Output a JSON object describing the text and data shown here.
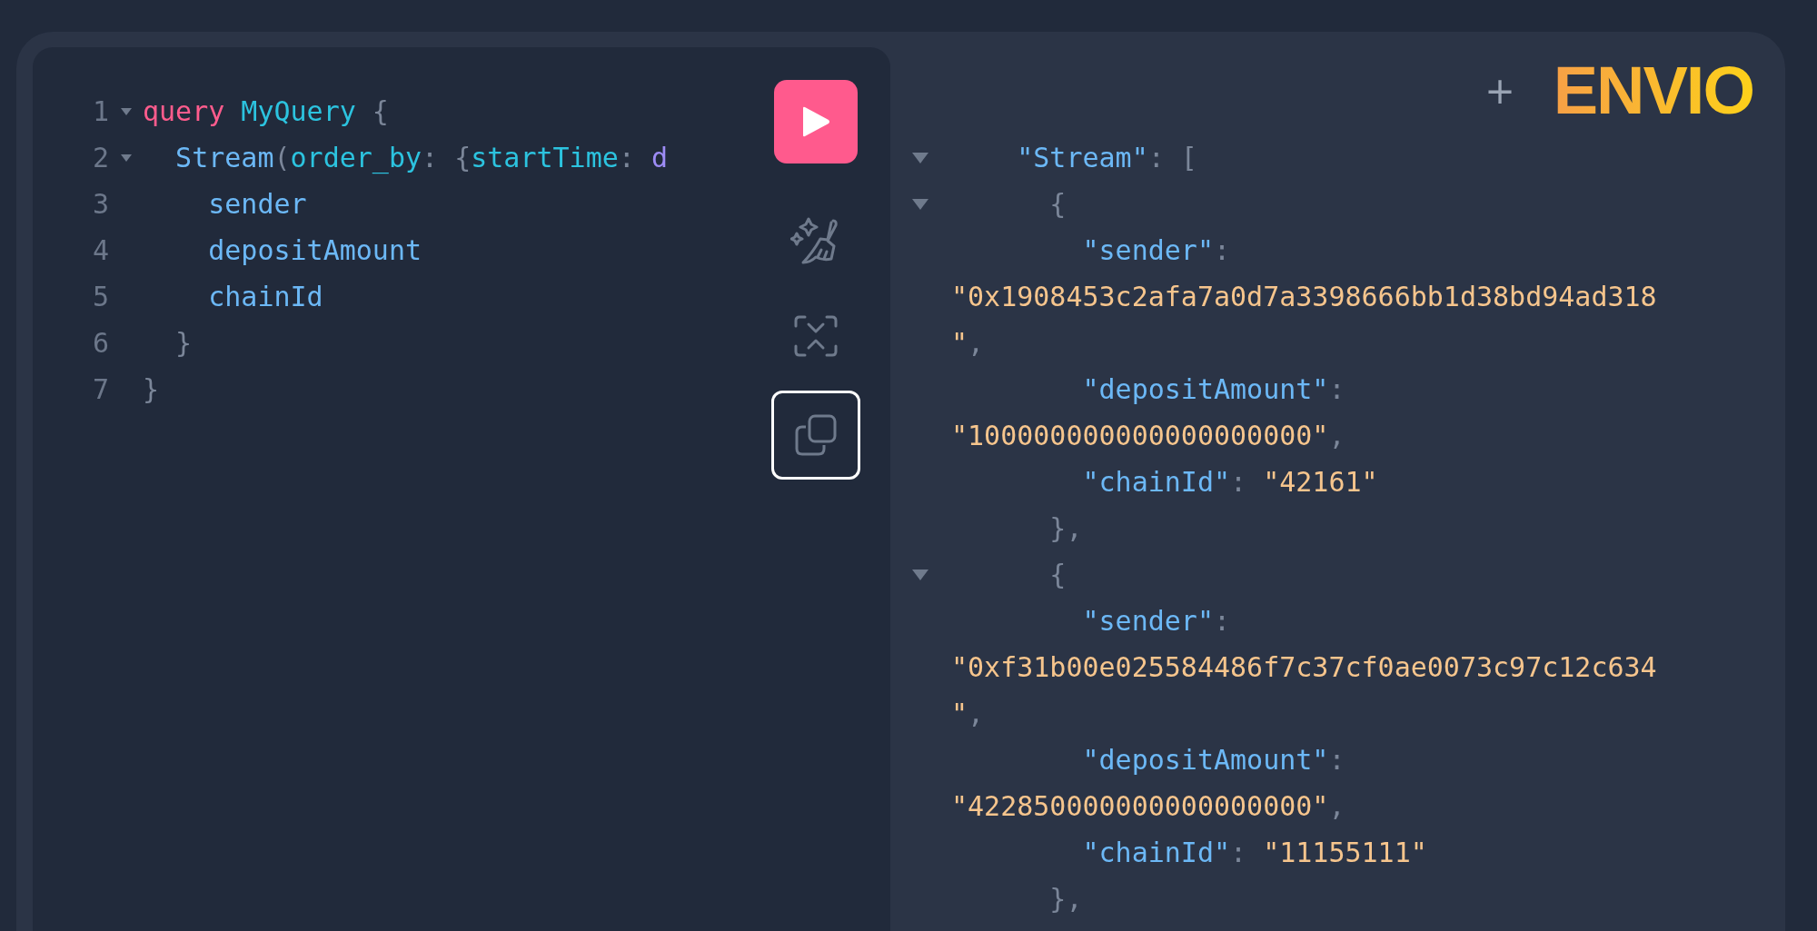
{
  "editor": {
    "lines": [
      {
        "number": "1",
        "foldable": true,
        "tokens": [
          {
            "text": "query",
            "kind": "keyword"
          },
          {
            "text": " MyQuery",
            "kind": "name"
          },
          {
            "text": " {",
            "kind": "punct"
          }
        ]
      },
      {
        "number": "2",
        "foldable": true,
        "tokens": [
          {
            "text": "  Stream",
            "kind": "field"
          },
          {
            "text": "(",
            "kind": "punct"
          },
          {
            "text": "order_by",
            "kind": "name"
          },
          {
            "text": ": {",
            "kind": "punct"
          },
          {
            "text": "startTime",
            "kind": "name"
          },
          {
            "text": ": ",
            "kind": "punct"
          },
          {
            "text": "d",
            "kind": "enum"
          }
        ]
      },
      {
        "number": "3",
        "foldable": false,
        "tokens": [
          {
            "text": "    sender",
            "kind": "field"
          }
        ]
      },
      {
        "number": "4",
        "foldable": false,
        "tokens": [
          {
            "text": "    depositAmount",
            "kind": "field"
          }
        ]
      },
      {
        "number": "5",
        "foldable": false,
        "tokens": [
          {
            "text": "    chainId",
            "kind": "field"
          }
        ]
      },
      {
        "number": "6",
        "foldable": false,
        "tokens": [
          {
            "text": "  }",
            "kind": "punct"
          }
        ]
      },
      {
        "number": "7",
        "foldable": false,
        "tokens": [
          {
            "text": "}",
            "kind": "punct"
          }
        ]
      }
    ],
    "tools": [
      {
        "kind": "run",
        "focused": false
      },
      {
        "kind": "prettify",
        "focused": false
      },
      {
        "kind": "merge",
        "focused": false
      },
      {
        "kind": "copy",
        "focused": true
      }
    ]
  },
  "result": {
    "add_label": "+",
    "logo": "ENVIO",
    "lines": [
      {
        "foldable": true,
        "tokens": [
          {
            "text": "    \"Stream\"",
            "kind": "key"
          },
          {
            "text": ": [",
            "kind": "punct"
          }
        ]
      },
      {
        "foldable": true,
        "tokens": [
          {
            "text": "      {",
            "kind": "punct"
          }
        ]
      },
      {
        "foldable": false,
        "tokens": [
          {
            "text": "        \"sender\"",
            "kind": "key"
          },
          {
            "text": ":",
            "kind": "punct"
          }
        ]
      },
      {
        "foldable": false,
        "tokens": [
          {
            "text": "\"0x1908453c2afa7a0d7a3398666bb1d38bd94ad318",
            "kind": "string"
          }
        ]
      },
      {
        "foldable": false,
        "tokens": [
          {
            "text": "\"",
            "kind": "string"
          },
          {
            "text": ",",
            "kind": "punct"
          }
        ]
      },
      {
        "foldable": false,
        "tokens": [
          {
            "text": "        \"depositAmount\"",
            "kind": "key"
          },
          {
            "text": ":",
            "kind": "punct"
          }
        ]
      },
      {
        "foldable": false,
        "tokens": [
          {
            "text": "\"100000000000000000000\"",
            "kind": "string"
          },
          {
            "text": ",",
            "kind": "punct"
          }
        ]
      },
      {
        "foldable": false,
        "tokens": [
          {
            "text": "        \"chainId\"",
            "kind": "key"
          },
          {
            "text": ": ",
            "kind": "punct"
          },
          {
            "text": "\"42161\"",
            "kind": "string"
          }
        ]
      },
      {
        "foldable": false,
        "tokens": [
          {
            "text": "      },",
            "kind": "punct"
          }
        ]
      },
      {
        "foldable": true,
        "tokens": [
          {
            "text": "      {",
            "kind": "punct"
          }
        ]
      },
      {
        "foldable": false,
        "tokens": [
          {
            "text": "        \"sender\"",
            "kind": "key"
          },
          {
            "text": ":",
            "kind": "punct"
          }
        ]
      },
      {
        "foldable": false,
        "tokens": [
          {
            "text": "\"0xf31b00e025584486f7c37cf0ae0073c97c12c634",
            "kind": "string"
          }
        ]
      },
      {
        "foldable": false,
        "tokens": [
          {
            "text": "\"",
            "kind": "string"
          },
          {
            "text": ",",
            "kind": "punct"
          }
        ]
      },
      {
        "foldable": false,
        "tokens": [
          {
            "text": "        \"depositAmount\"",
            "kind": "key"
          },
          {
            "text": ":",
            "kind": "punct"
          }
        ]
      },
      {
        "foldable": false,
        "tokens": [
          {
            "text": "\"422850000000000000000\"",
            "kind": "string"
          },
          {
            "text": ",",
            "kind": "punct"
          }
        ]
      },
      {
        "foldable": false,
        "tokens": [
          {
            "text": "        \"chainId\"",
            "kind": "key"
          },
          {
            "text": ": ",
            "kind": "punct"
          },
          {
            "text": "\"11155111\"",
            "kind": "string"
          }
        ]
      },
      {
        "foldable": false,
        "tokens": [
          {
            "text": "      },",
            "kind": "punct"
          }
        ]
      }
    ]
  }
}
